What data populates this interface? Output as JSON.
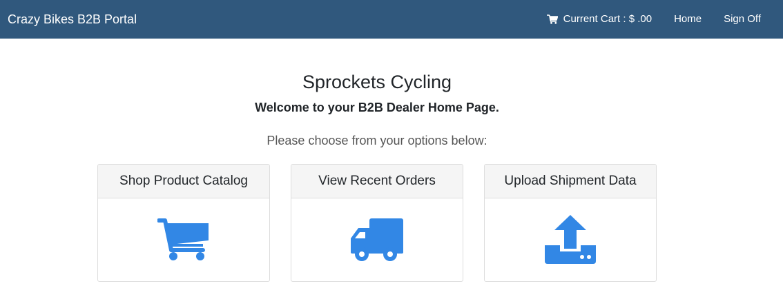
{
  "navbar": {
    "brand": "Crazy Bikes B2B Portal",
    "cart_label": "Current Cart : $ .00",
    "cart_icon": "shopping-cart-icon",
    "home_label": "Home",
    "signoff_label": "Sign Off",
    "background_color": "#30587d"
  },
  "main": {
    "title": "Sprockets Cycling",
    "subtitle": "Welcome to your B2B Dealer Home Page.",
    "instruction": "Please choose from your options below:"
  },
  "options": [
    {
      "label": "Shop Product Catalog",
      "icon": "shopping-cart-icon"
    },
    {
      "label": "View Recent Orders",
      "icon": "truck-icon"
    },
    {
      "label": "Upload Shipment Data",
      "icon": "upload-icon"
    }
  ],
  "colors": {
    "icon": "#3287e5",
    "card_header_bg": "#f5f5f5",
    "card_border": "#dddddd"
  }
}
